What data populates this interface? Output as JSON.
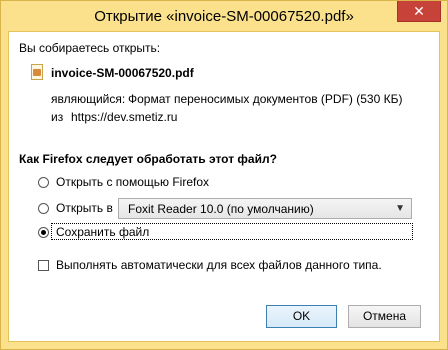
{
  "window": {
    "title": "Открытие «invoice-SM-00067520.pdf»",
    "close_glyph": "✕"
  },
  "intro": "Вы собираетесь открыть:",
  "file": {
    "name": "invoice-SM-00067520.pdf",
    "type_label": "являющийся:",
    "type_value": "Формат переносимых документов (PDF) (530 КБ)",
    "from_label": "из",
    "from_value": "https://dev.smetiz.ru"
  },
  "question": "Как Firefox следует обработать этот файл?",
  "options": [
    {
      "label": "Открыть с помощью Firefox",
      "checked": false
    },
    {
      "label": "Открыть в",
      "checked": false
    },
    {
      "label": "Сохранить файл",
      "checked": true
    }
  ],
  "app_select": {
    "value": "Foxit Reader 10.0 (по умолчанию)"
  },
  "auto_checkbox": {
    "label": "Выполнять автоматически для всех файлов данного типа.",
    "checked": false
  },
  "buttons": {
    "ok": "OK",
    "cancel": "Отмена"
  }
}
